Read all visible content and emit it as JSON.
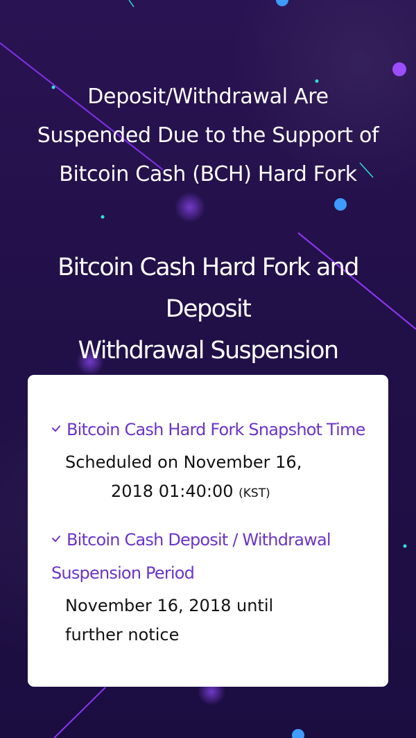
{
  "headline_primary": {
    "line1": "Deposit/Withdrawal Are",
    "line2": "Suspended Due to the Support of",
    "line3": "Bitcoin Cash (BCH) Hard Fork"
  },
  "headline_secondary": {
    "line1": "Bitcoin Cash Hard Fork and Deposit",
    "line2": "Withdrawal Suspension"
  },
  "card": {
    "snapshot": {
      "title": "Bitcoin Cash Hard Fork Snapshot Time",
      "line1": "Scheduled on November 16,",
      "line2": "2018 01:40:00",
      "timezone": "(KST)"
    },
    "suspension": {
      "title_line1": "Bitcoin Cash Deposit / Withdrawal",
      "title_line2": "Suspension Period",
      "line1": "November 16, 2018 until",
      "line2": "further notice"
    }
  },
  "colors": {
    "background": "#24104a",
    "accent_purple": "#6b35c9",
    "accent_cyan": "#2de0e0",
    "accent_blue": "#3e9bff",
    "accent_violet": "#9b4dff"
  },
  "icons": {
    "bullet": "check-icon"
  }
}
